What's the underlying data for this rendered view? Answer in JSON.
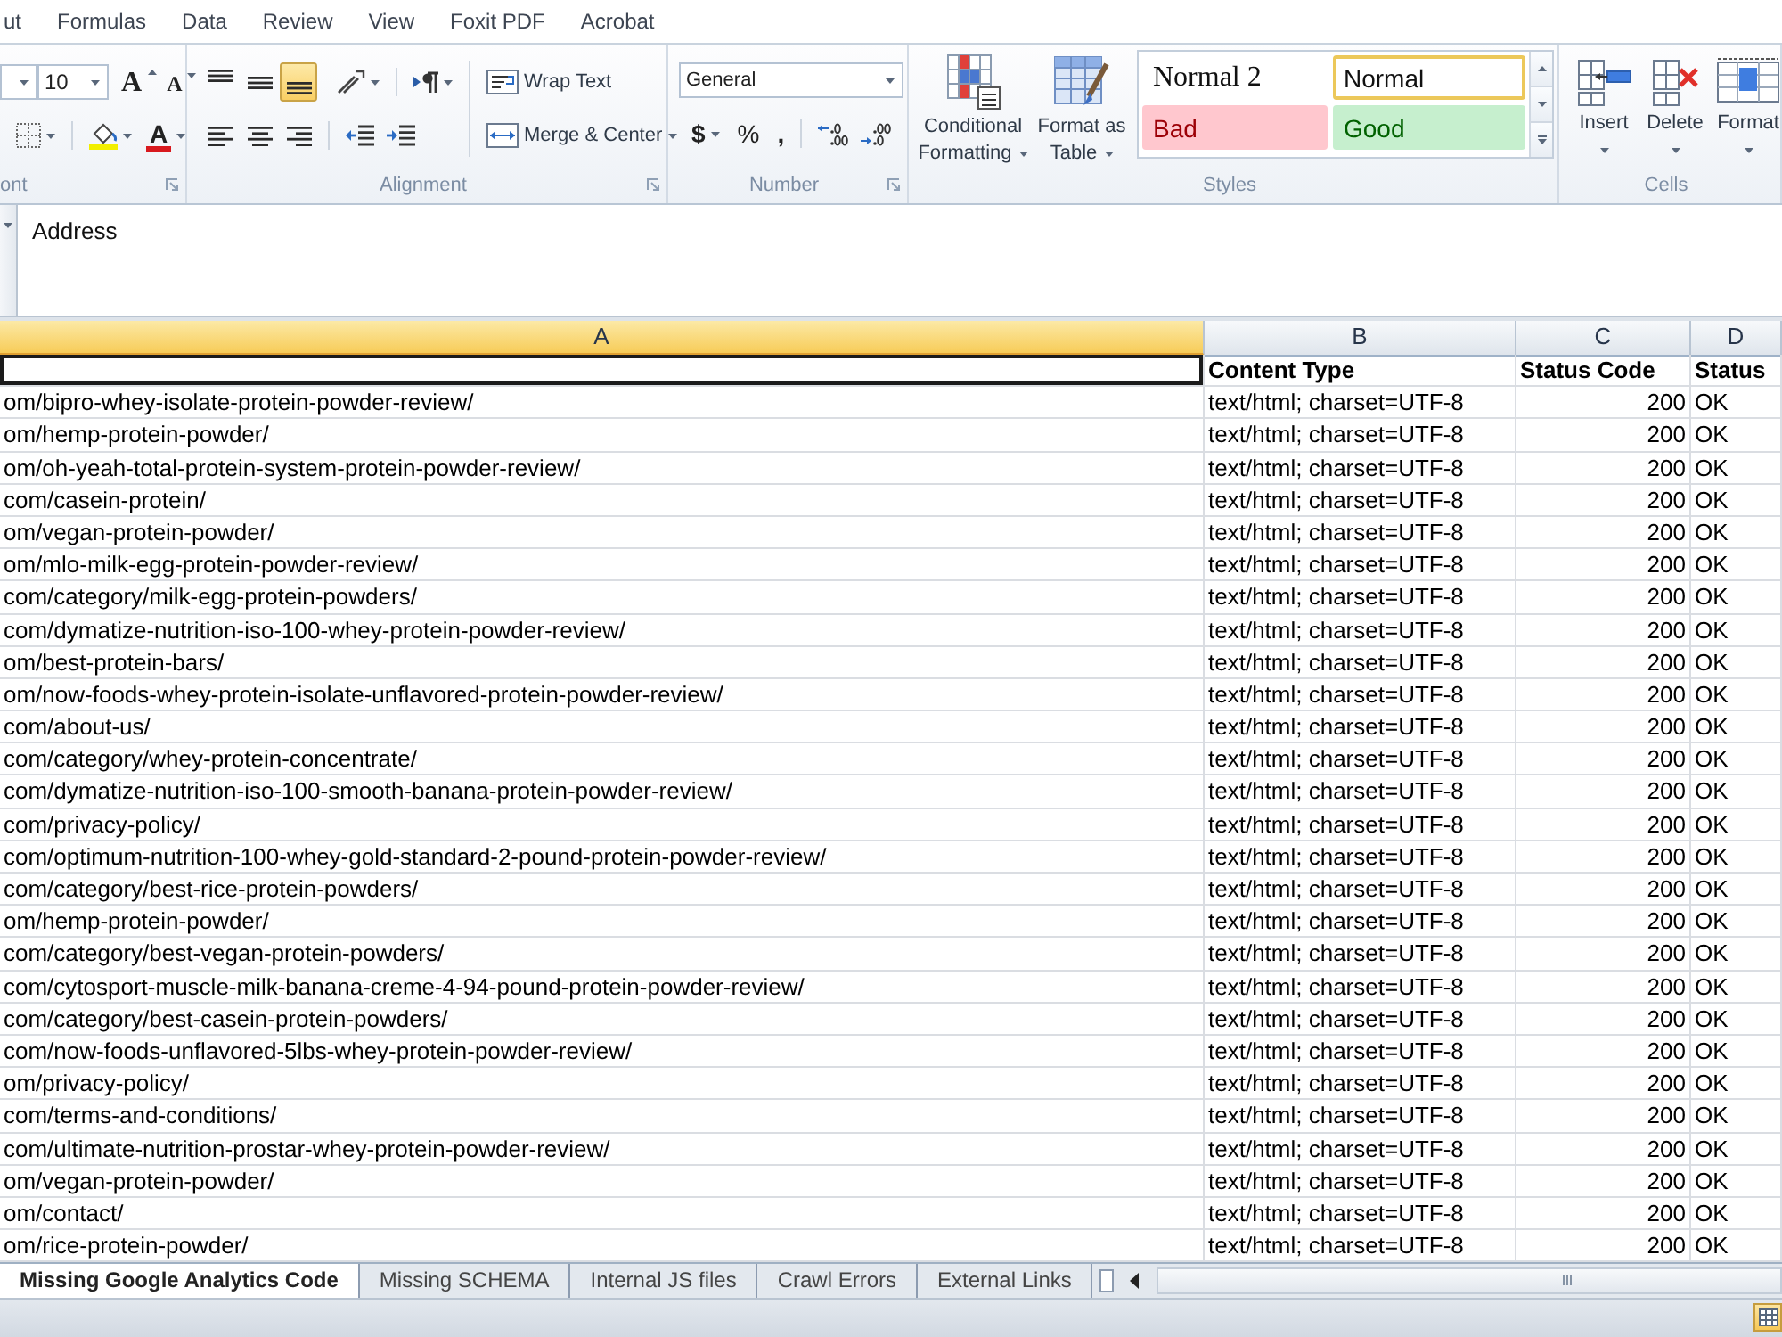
{
  "ribbon_tabs": [
    {
      "label": "ut",
      "selected": false
    },
    {
      "label": "Formulas",
      "selected": false
    },
    {
      "label": "Data",
      "selected": false
    },
    {
      "label": "Review",
      "selected": false
    },
    {
      "label": "View",
      "selected": false
    },
    {
      "label": "Foxit PDF",
      "selected": false
    },
    {
      "label": "Acrobat",
      "selected": false
    }
  ],
  "font_group": {
    "label": "ont",
    "font_size": "10",
    "grow_font": "A",
    "shrink_font": "A",
    "font_color": "A"
  },
  "alignment_group": {
    "label": "Alignment",
    "vertical_align": [
      {
        "kind": "top",
        "selected": false
      },
      {
        "kind": "middle",
        "selected": false
      },
      {
        "kind": "bottom",
        "selected": true
      }
    ],
    "horizontal_align": [
      {
        "kind": "left",
        "selected": false
      },
      {
        "kind": "center",
        "selected": false
      },
      {
        "kind": "right",
        "selected": false
      }
    ],
    "wrap_text": "Wrap Text",
    "merge_center": "Merge & Center"
  },
  "number_group": {
    "label": "Number",
    "format": "General",
    "currency": "$",
    "percent": "%",
    "comma": ","
  },
  "styles_group": {
    "label": "Styles",
    "conditional_formatting": "Conditional Formatting",
    "format_as_table": "Format as Table",
    "gallery": [
      {
        "label": "Normal 2",
        "kind": "normal2",
        "selected": false
      },
      {
        "label": "Normal",
        "kind": "normal",
        "selected": true
      },
      {
        "label": "Bad",
        "kind": "bad",
        "selected": false
      },
      {
        "label": "Good",
        "kind": "good",
        "selected": false
      }
    ]
  },
  "cells_group": {
    "label": "Cells",
    "buttons": [
      {
        "label": "Insert",
        "kind": "insert"
      },
      {
        "label": "Delete",
        "kind": "delete"
      },
      {
        "label": "Format",
        "kind": "format"
      }
    ]
  },
  "formula_bar": {
    "value": "Address"
  },
  "columns": [
    {
      "label": "A",
      "selected": true
    },
    {
      "label": "B",
      "selected": false
    },
    {
      "label": "C",
      "selected": false
    },
    {
      "label": "D",
      "selected": false
    }
  ],
  "header_row": {
    "cells": [
      {
        "selected": true
      },
      {
        "text": "Content Type",
        "selected": false
      },
      {
        "text": "Status Code",
        "selected": false
      },
      {
        "text": "Status",
        "selected": false
      }
    ]
  },
  "rows": [
    {
      "column_a": "om/bipro-whey-isolate-protein-powder-review/",
      "content_type": "text/html; charset=UTF-8",
      "status_code": "200",
      "status": "OK"
    },
    {
      "column_a": "om/hemp-protein-powder/",
      "content_type": "text/html; charset=UTF-8",
      "status_code": "200",
      "status": "OK"
    },
    {
      "column_a": "om/oh-yeah-total-protein-system-protein-powder-review/",
      "content_type": "text/html; charset=UTF-8",
      "status_code": "200",
      "status": "OK"
    },
    {
      "column_a": "com/casein-protein/",
      "content_type": "text/html; charset=UTF-8",
      "status_code": "200",
      "status": "OK"
    },
    {
      "column_a": "om/vegan-protein-powder/",
      "content_type": "text/html; charset=UTF-8",
      "status_code": "200",
      "status": "OK"
    },
    {
      "column_a": "om/mlo-milk-egg-protein-powder-review/",
      "content_type": "text/html; charset=UTF-8",
      "status_code": "200",
      "status": "OK"
    },
    {
      "column_a": "com/category/milk-egg-protein-powders/",
      "content_type": "text/html; charset=UTF-8",
      "status_code": "200",
      "status": "OK"
    },
    {
      "column_a": "com/dymatize-nutrition-iso-100-whey-protein-powder-review/",
      "content_type": "text/html; charset=UTF-8",
      "status_code": "200",
      "status": "OK"
    },
    {
      "column_a": "om/best-protein-bars/",
      "content_type": "text/html; charset=UTF-8",
      "status_code": "200",
      "status": "OK"
    },
    {
      "column_a": "om/now-foods-whey-protein-isolate-unflavored-protein-powder-review/",
      "content_type": "text/html; charset=UTF-8",
      "status_code": "200",
      "status": "OK"
    },
    {
      "column_a": "com/about-us/",
      "content_type": "text/html; charset=UTF-8",
      "status_code": "200",
      "status": "OK"
    },
    {
      "column_a": "com/category/whey-protein-concentrate/",
      "content_type": "text/html; charset=UTF-8",
      "status_code": "200",
      "status": "OK"
    },
    {
      "column_a": "com/dymatize-nutrition-iso-100-smooth-banana-protein-powder-review/",
      "content_type": "text/html; charset=UTF-8",
      "status_code": "200",
      "status": "OK"
    },
    {
      "column_a": "com/privacy-policy/",
      "content_type": "text/html; charset=UTF-8",
      "status_code": "200",
      "status": "OK"
    },
    {
      "column_a": "com/optimum-nutrition-100-whey-gold-standard-2-pound-protein-powder-review/",
      "content_type": "text/html; charset=UTF-8",
      "status_code": "200",
      "status": "OK"
    },
    {
      "column_a": "com/category/best-rice-protein-powders/",
      "content_type": "text/html; charset=UTF-8",
      "status_code": "200",
      "status": "OK"
    },
    {
      "column_a": "om/hemp-protein-powder/",
      "content_type": "text/html; charset=UTF-8",
      "status_code": "200",
      "status": "OK"
    },
    {
      "column_a": "com/category/best-vegan-protein-powders/",
      "content_type": "text/html; charset=UTF-8",
      "status_code": "200",
      "status": "OK"
    },
    {
      "column_a": "com/cytosport-muscle-milk-banana-creme-4-94-pound-protein-powder-review/",
      "content_type": "text/html; charset=UTF-8",
      "status_code": "200",
      "status": "OK"
    },
    {
      "column_a": "com/category/best-casein-protein-powders/",
      "content_type": "text/html; charset=UTF-8",
      "status_code": "200",
      "status": "OK"
    },
    {
      "column_a": "com/now-foods-unflavored-5lbs-whey-protein-powder-review/",
      "content_type": "text/html; charset=UTF-8",
      "status_code": "200",
      "status": "OK"
    },
    {
      "column_a": "om/privacy-policy/",
      "content_type": "text/html; charset=UTF-8",
      "status_code": "200",
      "status": "OK"
    },
    {
      "column_a": "com/terms-and-conditions/",
      "content_type": "text/html; charset=UTF-8",
      "status_code": "200",
      "status": "OK"
    },
    {
      "column_a": "com/ultimate-nutrition-prostar-whey-protein-powder-review/",
      "content_type": "text/html; charset=UTF-8",
      "status_code": "200",
      "status": "OK"
    },
    {
      "column_a": "om/vegan-protein-powder/",
      "content_type": "text/html; charset=UTF-8",
      "status_code": "200",
      "status": "OK"
    },
    {
      "column_a": "om/contact/",
      "content_type": "text/html; charset=UTF-8",
      "status_code": "200",
      "status": "OK"
    },
    {
      "column_a": "om/rice-protein-powder/",
      "content_type": "text/html; charset=UTF-8",
      "status_code": "200",
      "status": "OK"
    }
  ],
  "sheet_tabs": [
    {
      "label": "Missing Google Analytics Code",
      "selected": true
    },
    {
      "label": "Missing SCHEMA",
      "selected": false
    },
    {
      "label": "Internal JS files",
      "selected": false
    },
    {
      "label": "Crawl Errors",
      "selected": false
    },
    {
      "label": "External Links",
      "selected": false
    }
  ]
}
